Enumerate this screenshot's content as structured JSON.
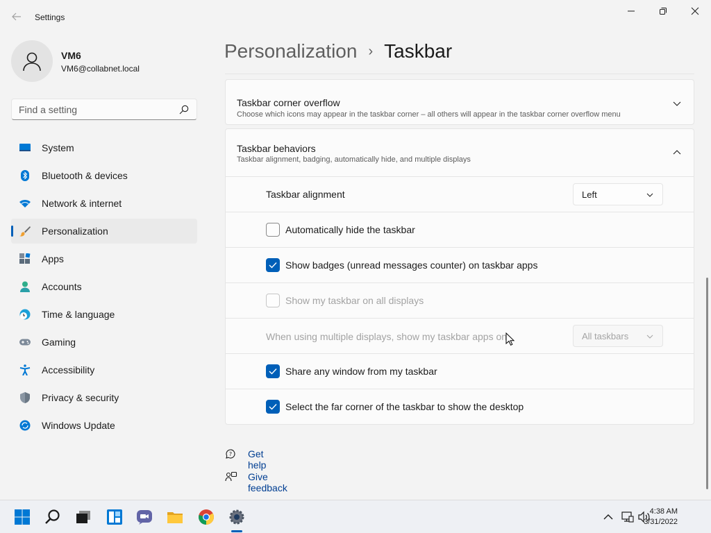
{
  "window": {
    "title": "Settings"
  },
  "profile": {
    "name": "VM6",
    "email": "VM6@collabnet.local"
  },
  "search": {
    "placeholder": "Find a setting"
  },
  "sidebar": {
    "items": [
      {
        "label": "System",
        "icon": "system-icon"
      },
      {
        "label": "Bluetooth & devices",
        "icon": "bluetooth-icon"
      },
      {
        "label": "Network & internet",
        "icon": "wifi-icon"
      },
      {
        "label": "Personalization",
        "icon": "brush-icon",
        "active": true
      },
      {
        "label": "Apps",
        "icon": "apps-icon"
      },
      {
        "label": "Accounts",
        "icon": "accounts-icon"
      },
      {
        "label": "Time & language",
        "icon": "clock-globe-icon"
      },
      {
        "label": "Gaming",
        "icon": "gamepad-icon"
      },
      {
        "label": "Accessibility",
        "icon": "accessibility-icon"
      },
      {
        "label": "Privacy & security",
        "icon": "shield-icon"
      },
      {
        "label": "Windows Update",
        "icon": "update-icon"
      }
    ]
  },
  "header": {
    "parent": "Personalization",
    "separator": "›",
    "current": "Taskbar"
  },
  "overflow_card": {
    "title": "Taskbar corner overflow",
    "description": "Choose which icons may appear in the taskbar corner – all others will appear in the taskbar corner overflow menu"
  },
  "behaviors_card": {
    "title": "Taskbar behaviors",
    "description": "Taskbar alignment, badging, automatically hide, and multiple displays",
    "alignment": {
      "label": "Taskbar alignment",
      "value": "Left"
    },
    "options": {
      "auto_hide": {
        "label": "Automatically hide the taskbar",
        "checked": false
      },
      "badges": {
        "label": "Show badges (unread messages counter) on taskbar apps",
        "checked": true
      },
      "all_displays": {
        "label": "Show my taskbar on all displays",
        "checked": false,
        "disabled": true
      },
      "share_window": {
        "label": "Share any window from my taskbar",
        "checked": true
      },
      "far_corner": {
        "label": "Select the far corner of the taskbar to show the desktop",
        "checked": true
      }
    },
    "multi_display": {
      "label": "When using multiple displays, show my taskbar apps on",
      "value": "All taskbars",
      "disabled": true
    }
  },
  "help": {
    "get_help": "Get help",
    "give_feedback": "Give feedback"
  },
  "taskbar": {
    "apps": [
      "start-icon",
      "search-icon",
      "task-view-icon",
      "widgets-icon",
      "chat-icon",
      "file-explorer-icon",
      "chrome-icon",
      "settings-icon"
    ],
    "clock": {
      "time": "4:38 AM",
      "date": "3/31/2022"
    }
  },
  "colors": {
    "accent": "#005fb8",
    "background": "#f3f3f3",
    "card": "#fbfbfb"
  }
}
